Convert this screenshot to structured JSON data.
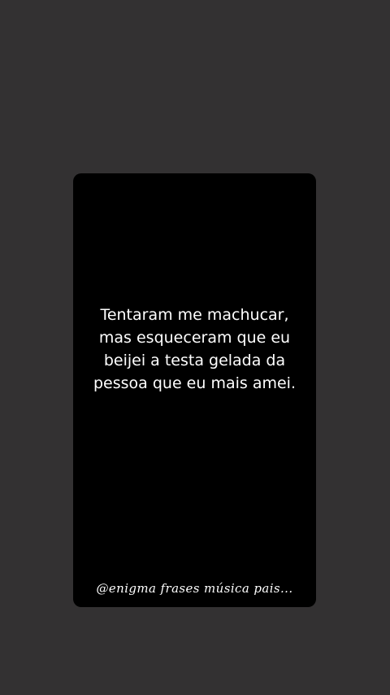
{
  "story": {
    "quote": "Tentaram me machucar, mas esqueceram que eu beijei a testa gelada da pessoa que eu mais amei.",
    "author_tag": "@enigma frases música pais..."
  },
  "colors": {
    "screen_background": "#333132",
    "card_background": "#000000",
    "text": "#ffffff"
  }
}
